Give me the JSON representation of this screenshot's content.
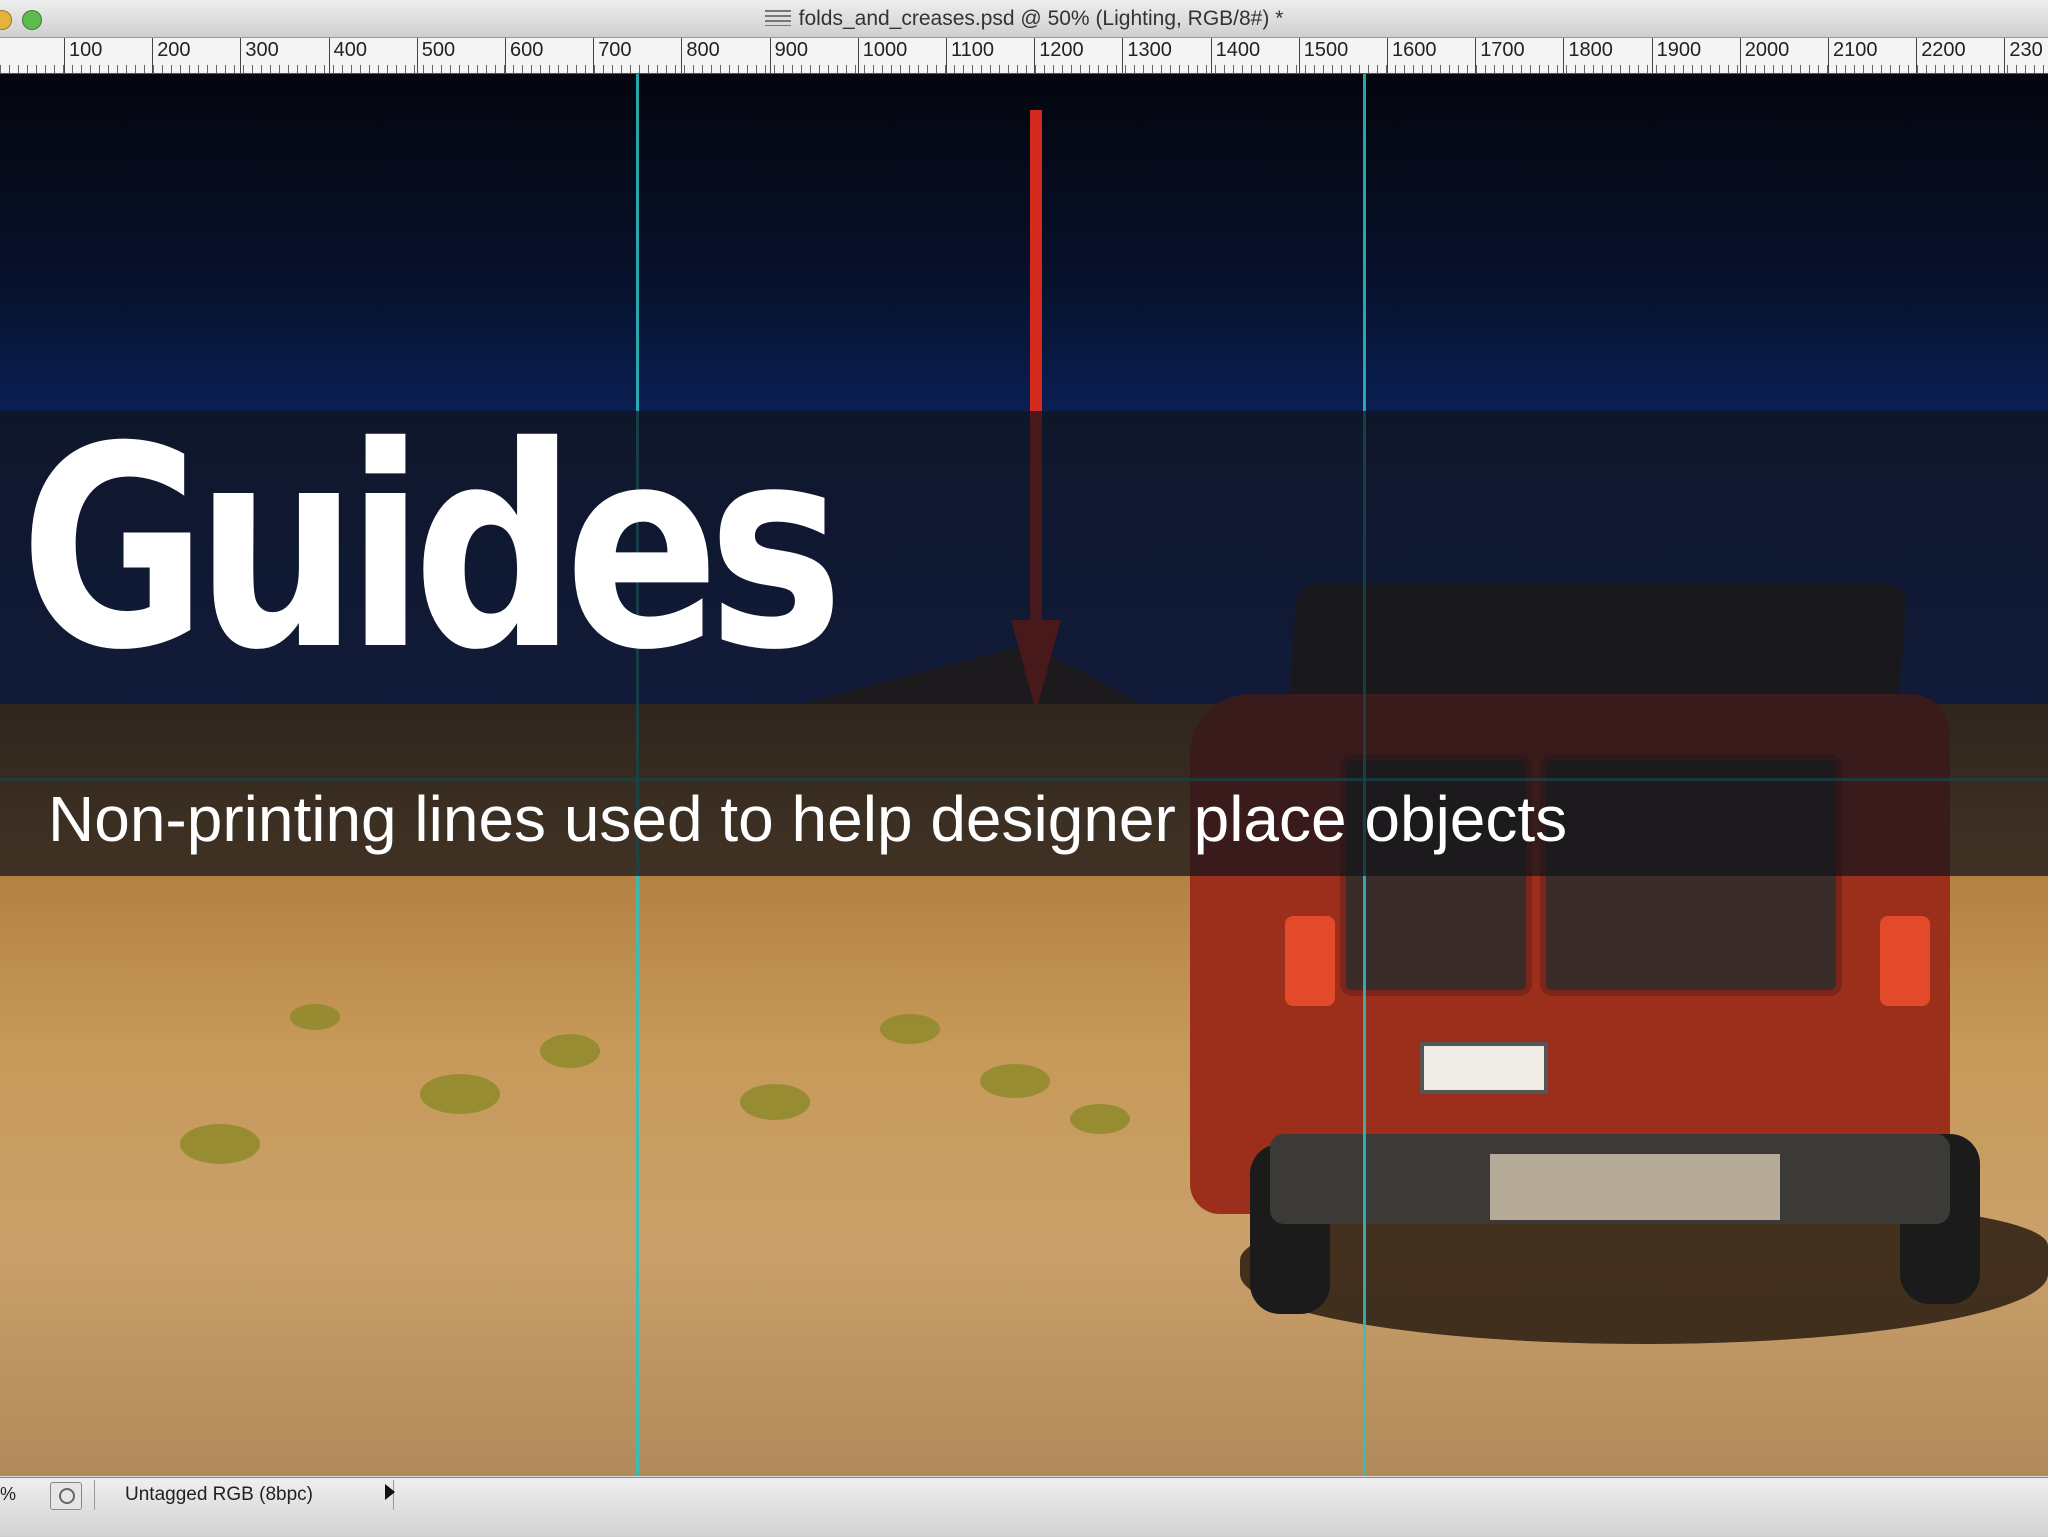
{
  "window": {
    "doc_icon": "document-icon",
    "title": "folds_and_creases.psd @ 50% (Lighting, RGB/8#) *"
  },
  "ruler": {
    "ticks": [
      "100",
      "200",
      "300",
      "400",
      "500",
      "600",
      "700",
      "800",
      "900",
      "1000",
      "1100",
      "1200",
      "1300",
      "1400",
      "1500",
      "1600",
      "1700",
      "1800",
      "1900",
      "2000",
      "2100",
      "2200",
      "230"
    ]
  },
  "overlay": {
    "title": "Guides",
    "subtitle": "Non-printing lines used to help designer place objects"
  },
  "statusbar": {
    "zoom": "%",
    "doc_profile": "Untagged RGB (8bpc)"
  },
  "colors": {
    "guide": "#2bc2c2",
    "arrow": "#d42a1e"
  }
}
